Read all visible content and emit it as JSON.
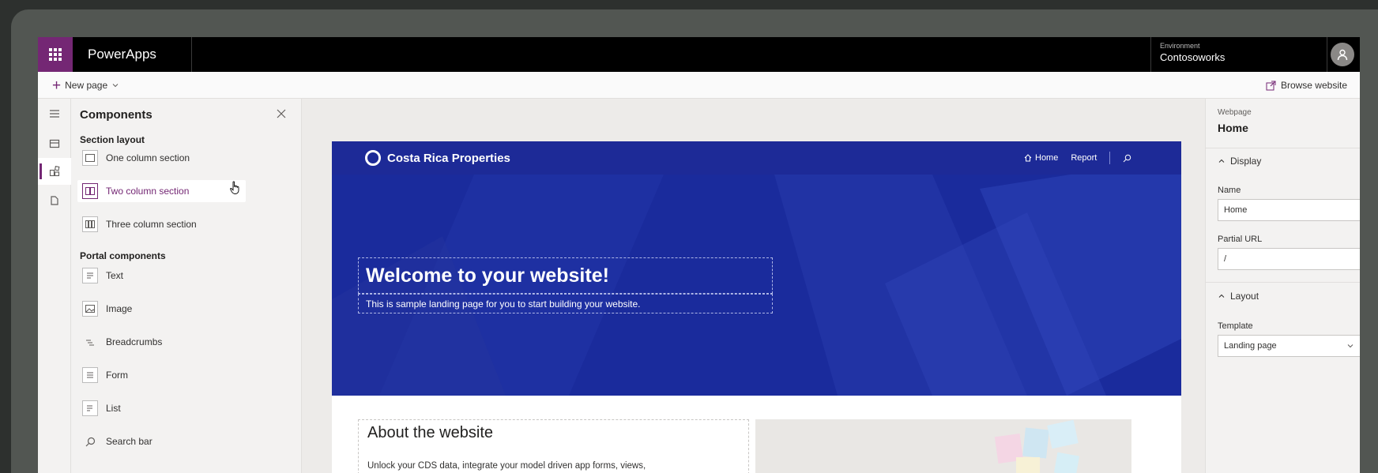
{
  "topbar": {
    "app_name": "PowerApps",
    "environment_label": "Environment",
    "environment_value": "Contosoworks"
  },
  "commandbar": {
    "new_page": "New page",
    "browse_website": "Browse website"
  },
  "rail": {
    "icons": [
      "hamburger-icon",
      "pages-icon",
      "components-icon",
      "files-icon"
    ]
  },
  "components": {
    "title": "Components",
    "section_layout_label": "Section layout",
    "section_items": [
      {
        "label": "One column section",
        "icon": "one-column-icon"
      },
      {
        "label": "Two column section",
        "icon": "two-column-icon"
      },
      {
        "label": "Three column section",
        "icon": "three-column-icon"
      }
    ],
    "portal_label": "Portal components",
    "portal_items": [
      {
        "label": "Text",
        "icon": "text-icon"
      },
      {
        "label": "Image",
        "icon": "image-icon"
      },
      {
        "label": "Breadcrumbs",
        "icon": "breadcrumbs-icon"
      },
      {
        "label": "Form",
        "icon": "form-icon"
      },
      {
        "label": "List",
        "icon": "list-icon"
      },
      {
        "label": "Search bar",
        "icon": "search-icon"
      }
    ]
  },
  "site": {
    "brand": "Costa Rica Properties",
    "nav": {
      "home": "Home",
      "report": "Report"
    },
    "hero_title": "Welcome to your website!",
    "hero_subtitle": "This is sample landing page for you to start building your website.",
    "about_title": "About the website",
    "about_text": "Unlock your CDS data, integrate your model driven app forms, views,"
  },
  "props": {
    "type_label": "Webpage",
    "page_name": "Home",
    "display_header": "Display",
    "name_label": "Name",
    "name_value": "Home",
    "url_label": "Partial URL",
    "url_value": "/",
    "layout_header": "Layout",
    "template_label": "Template",
    "template_value": "Landing page"
  },
  "colors": {
    "accent": "#742774",
    "hero": "#1a2b9c",
    "topbar": "#000000"
  }
}
